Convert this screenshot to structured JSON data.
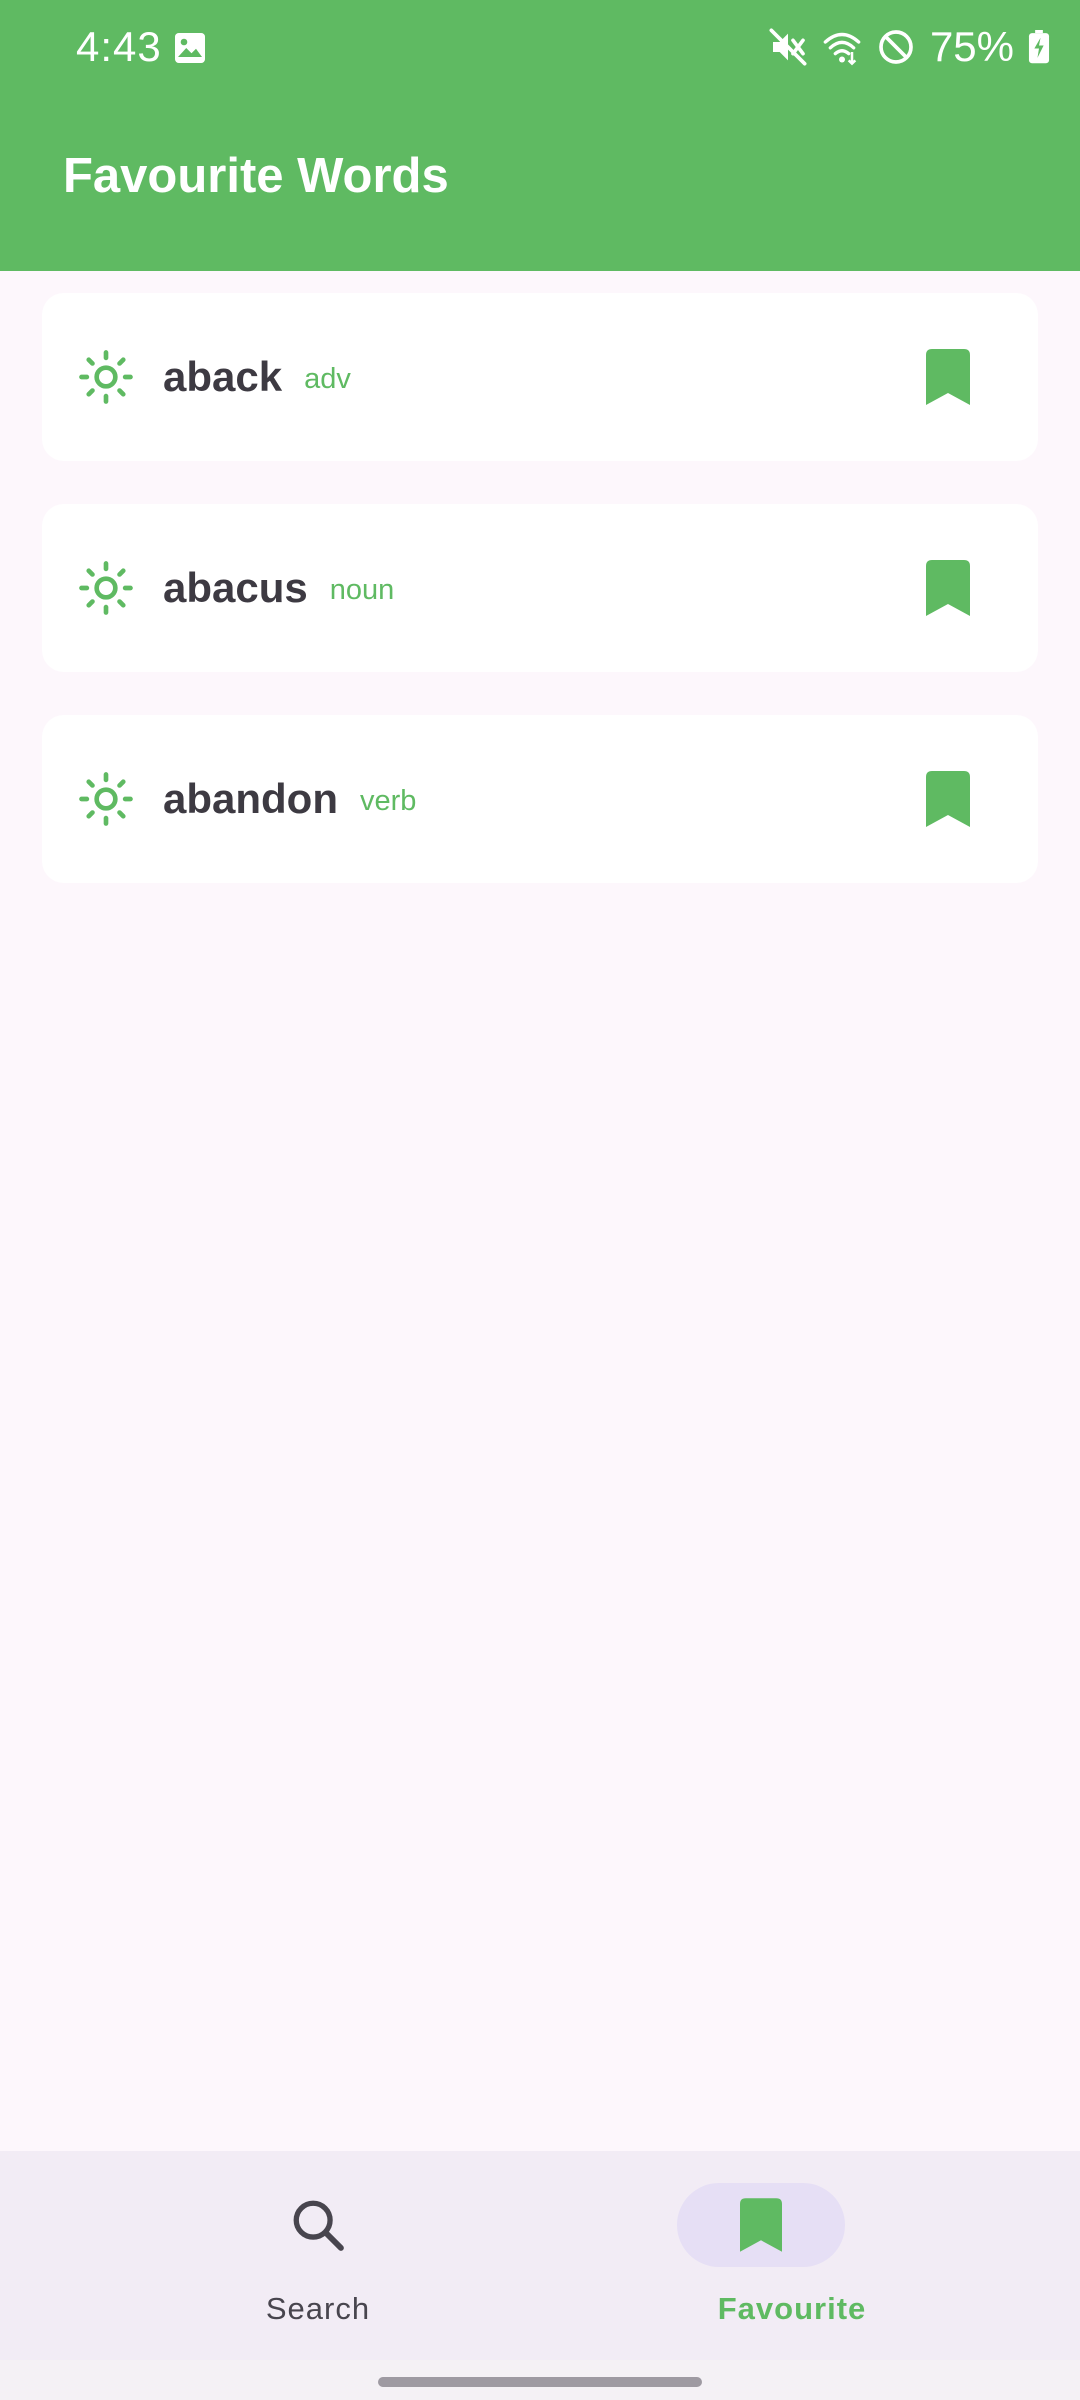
{
  "status_bar": {
    "time": "4:43",
    "battery": "75%",
    "icons": [
      "gallery-icon",
      "mute-icon",
      "wifi-icon",
      "do-not-disturb-icon",
      "battery-charging-icon"
    ]
  },
  "app_bar": {
    "title": "Favourite Words"
  },
  "words": [
    {
      "term": "aback",
      "pos": "adv",
      "icon": "sun-icon",
      "bookmarked": true
    },
    {
      "term": "abacus",
      "pos": "noun",
      "icon": "sun-icon",
      "bookmarked": true
    },
    {
      "term": "abandon",
      "pos": "verb",
      "icon": "sun-icon",
      "bookmarked": true
    }
  ],
  "bottom_nav": {
    "search_label": "Search",
    "favourite_label": "Favourite",
    "selected": "favourite"
  },
  "colors": {
    "primary": "#5fba62",
    "background": "#fdf7fc",
    "card": "#ffffff",
    "text_dark": "#3d3a42",
    "nav_background": "#f2ecf5",
    "nav_pill": "#e6dff5"
  }
}
